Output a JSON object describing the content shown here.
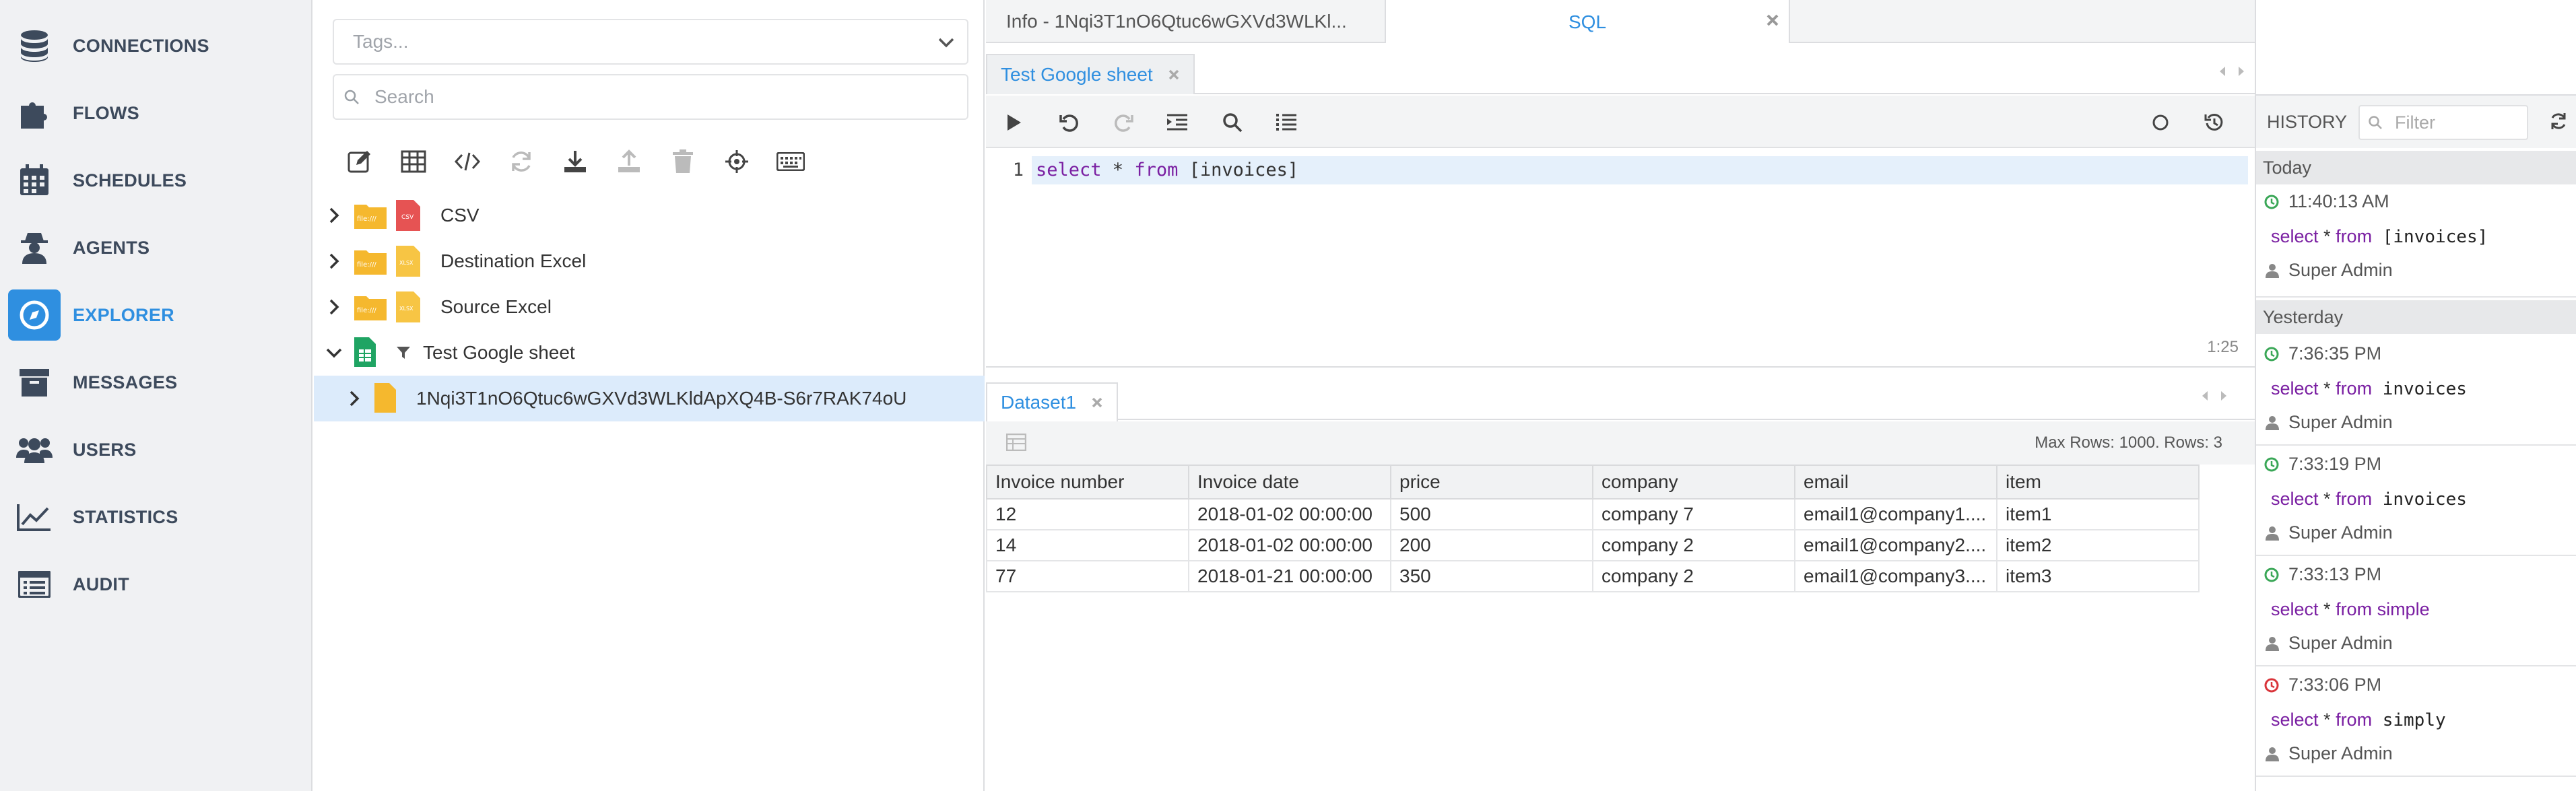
{
  "nav": {
    "items": [
      {
        "label": "CONNECTIONS",
        "icon": "database-icon"
      },
      {
        "label": "FLOWS",
        "icon": "puzzle-icon"
      },
      {
        "label": "SCHEDULES",
        "icon": "calendar-icon"
      },
      {
        "label": "AGENTS",
        "icon": "agent-icon"
      },
      {
        "label": "EXPLORER",
        "icon": "compass-icon",
        "active": true
      },
      {
        "label": "MESSAGES",
        "icon": "archive-icon"
      },
      {
        "label": "USERS",
        "icon": "users-icon"
      },
      {
        "label": "STATISTICS",
        "icon": "line-chart-icon"
      },
      {
        "label": "AUDIT",
        "icon": "list-icon"
      }
    ],
    "active_color": "#2f8fe0"
  },
  "explorer": {
    "tags_placeholder": "Tags...",
    "search_placeholder": "Search",
    "tree": [
      {
        "label": "CSV",
        "type": "csv"
      },
      {
        "label": "Destination Excel",
        "type": "xlsx"
      },
      {
        "label": "Source Excel",
        "type": "xlsx"
      },
      {
        "label": "Test Google sheet",
        "type": "gsheet"
      },
      {
        "label": "1Nqi3T1nO6Qtuc6wGXVd3WLKldApXQ4B-S6r7RAK74oU",
        "type": "sheet",
        "selected": true
      }
    ],
    "file_badge": "file:///",
    "csv_badge": "CSV",
    "xlsx_badge": "XLSX"
  },
  "main": {
    "top_tabs": [
      {
        "label": "Info - 1Nqi3T1nO6Qtuc6wGXVd3WLKl..."
      },
      {
        "label": "SQL",
        "active": true
      }
    ],
    "query_tab": "Test Google sheet",
    "editor": {
      "line_number": "1",
      "kw_select": "select",
      "star": " * ",
      "kw_from": "from",
      "table": " [invoices]",
      "cursor_pos": "1:25"
    },
    "results": {
      "tab": "Dataset1",
      "info": "Max Rows: 1000. Rows: 3",
      "columns": [
        "Invoice number",
        "Invoice date",
        "price",
        "company",
        "email",
        "item"
      ],
      "rows": [
        [
          "12",
          "2018-01-02 00:00:00",
          "500",
          "company 7",
          "email1@company1....",
          "item1"
        ],
        [
          "14",
          "2018-01-02 00:00:00",
          "200",
          "company 2",
          "email1@company2....",
          "item2"
        ],
        [
          "77",
          "2018-01-21 00:00:00",
          "350",
          "company 2",
          "email1@company3....",
          "item3"
        ]
      ]
    }
  },
  "history": {
    "title": "HISTORY",
    "filter_placeholder": "Filter",
    "groups": [
      {
        "label": "Today"
      },
      {
        "label": "Yesterday"
      }
    ],
    "entries": [
      {
        "time": "11:40:13 AM",
        "select": "select",
        "star": " * ",
        "from": "from",
        "table": " [invoices]",
        "user": "Super Admin",
        "status": "success"
      },
      {
        "time": "7:36:35 PM",
        "select": "select",
        "star": " * ",
        "from": "from",
        "table": " invoices",
        "user": "Super Admin",
        "status": "success"
      },
      {
        "time": "7:33:19 PM",
        "select": "select",
        "star": " * ",
        "from": "from",
        "table": " invoices",
        "user": "Super Admin",
        "status": "success"
      },
      {
        "time": "7:33:13 PM",
        "select": "select",
        "star": " * ",
        "from": "from",
        "table": " simple",
        "user": "Super Admin",
        "status": "success"
      },
      {
        "time": "7:33:06 PM",
        "select": "select",
        "star": " * ",
        "from": "from",
        "table": " simply",
        "user": "Super Admin",
        "status": "error"
      }
    ],
    "colors": {
      "success": "#3aa757",
      "error": "#d9343a",
      "keyword": "#7a1fa2"
    }
  }
}
